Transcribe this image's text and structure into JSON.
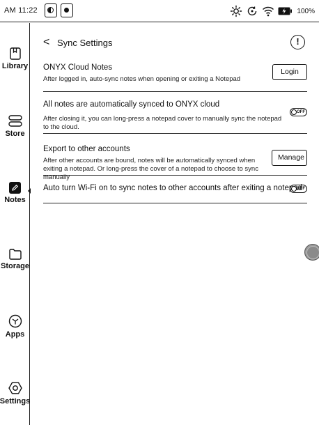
{
  "status_bar": {
    "time": "AM 11:22",
    "battery": "100%"
  },
  "sidebar": {
    "items": [
      {
        "label": "Library",
        "icon": "library-icon",
        "active": false
      },
      {
        "label": "Store",
        "icon": "store-icon",
        "active": false
      },
      {
        "label": "Notes",
        "icon": "notes-icon",
        "active": true
      },
      {
        "label": "Storage",
        "icon": "storage-icon",
        "active": false
      },
      {
        "label": "Apps",
        "icon": "apps-icon",
        "active": false
      },
      {
        "label": "Settings",
        "icon": "settings-icon",
        "active": false
      }
    ]
  },
  "header": {
    "back": "<",
    "title": "Sync Settings",
    "info": "!"
  },
  "settings": {
    "onyx_cloud": {
      "title": "ONYX Cloud Notes",
      "description": "After logged in, auto-sync notes when opening or exiting a Notepad",
      "button": "Login"
    },
    "auto_sync": {
      "title": "All notes are automatically synced to ONYX cloud",
      "description": "After closing it, you can long-press a notepad cover to manually sync the notepad to the cloud.",
      "toggle": "OFF"
    },
    "export": {
      "title": "Export to other accounts",
      "description": "After other accounts are bound, notes will be automatically synced when exiting a notepad. Or long-press the cover of a notepad to choose to sync manually",
      "button": "Manage"
    },
    "wifi": {
      "title": "Auto turn Wi-Fi on to sync notes to other accounts after exiting a notepad",
      "toggle": "OFF"
    }
  }
}
